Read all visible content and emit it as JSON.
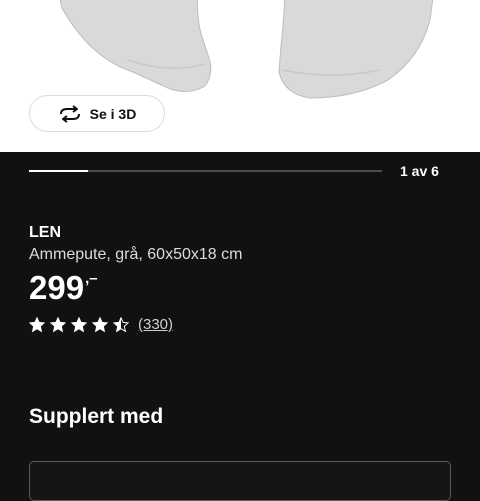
{
  "viewer": {
    "button_3d_label": "Se i 3D",
    "page_counter": "1 av 6",
    "progress_fraction": 0.1667
  },
  "product": {
    "brand": "LEN",
    "description": "Ammepute, grå, 60x50x18 cm",
    "price_integer": "299",
    "price_decimal": ",–",
    "rating": 4.5,
    "review_count": "(330)"
  },
  "sections": {
    "complement_title": "Supplert med"
  },
  "icons": {
    "rotate_3d": "rotate-3d-icon",
    "star": "star-icon"
  },
  "colors": {
    "background": "#111111",
    "text": "#ffffff",
    "pillow": "#d9d9d9"
  }
}
